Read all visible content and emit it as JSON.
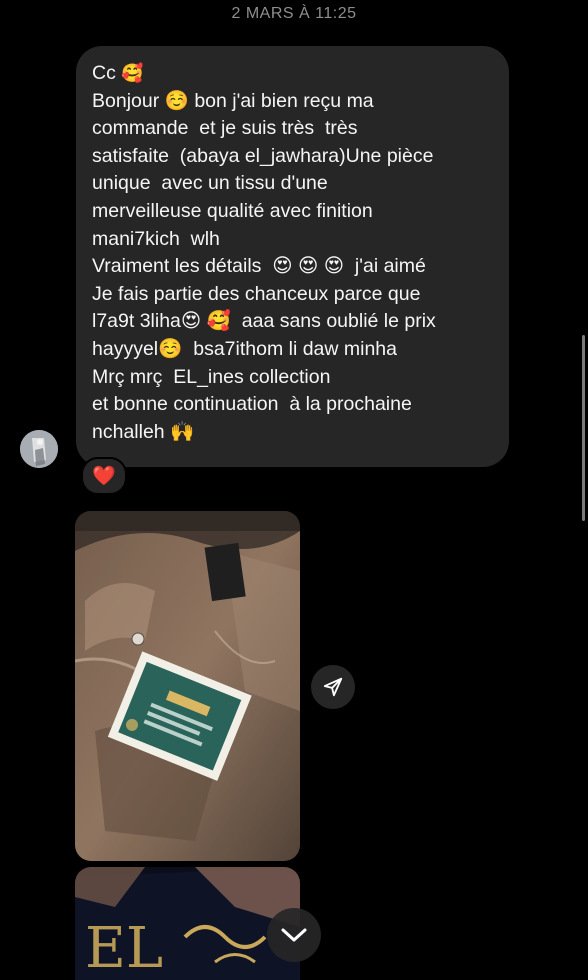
{
  "timestamp": "2 MARS À 11:25",
  "message": {
    "lines": [
      {
        "text": "Cc ",
        "emoji": "🥰"
      },
      {
        "text": "Bonjour ☺️ bon j'ai bien reçu ma"
      },
      {
        "text": "commande  et je suis très  très"
      },
      {
        "text": "satisfaite  (abaya el_jawhara)Une pièce"
      },
      {
        "text": "unique  avec un tissu d'une"
      },
      {
        "text": "merveilleuse qualité avec finition"
      },
      {
        "text": "mani7kich  wlh"
      },
      {
        "text": "Vraiment les détails  😍 😍 😍  j'ai aimé"
      },
      {
        "text": "Je fais partie des chanceux parce que"
      },
      {
        "text": "l7a9t 3liha😍 🥰  aaa sans oublié le prix"
      },
      {
        "text": "hayyyel☺️  bsa7ithom li daw minha"
      },
      {
        "text": "Mrç mrç  EL_ines collection"
      },
      {
        "text": "et bonne continuation  à la prochaine"
      },
      {
        "text": "nchalleh 🙌"
      }
    ]
  },
  "reaction": {
    "emoji": "❤️"
  },
  "icons": {
    "share": "paper-plane-icon",
    "scroll": "chevron-down-icon"
  },
  "colors": {
    "background": "#000000",
    "bubble": "#262626",
    "text": "#f5f5f5",
    "timestamp": "#8e8e8e",
    "heart": "#ed1c3e"
  }
}
